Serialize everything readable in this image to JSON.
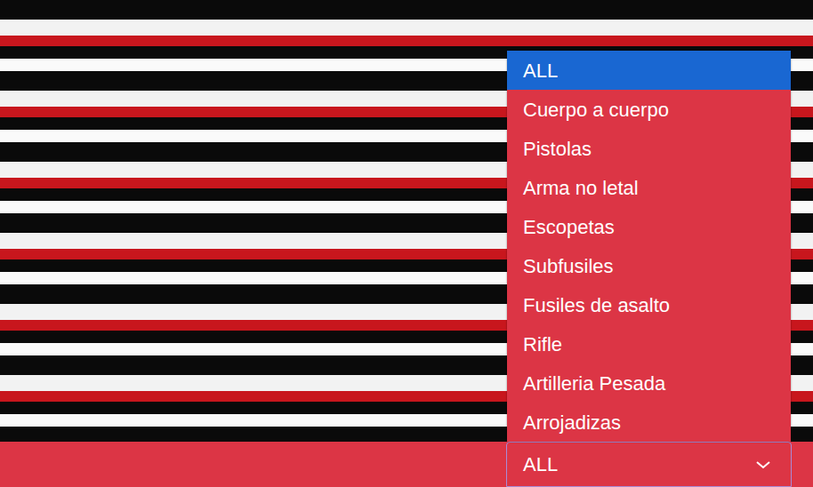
{
  "dropdown": {
    "value": "ALL",
    "expanded": true,
    "options": [
      {
        "label": "ALL",
        "selected": true
      },
      {
        "label": "Cuerpo a cuerpo",
        "selected": false
      },
      {
        "label": "Pistolas",
        "selected": false
      },
      {
        "label": "Arma no letal",
        "selected": false
      },
      {
        "label": "Escopetas",
        "selected": false
      },
      {
        "label": "Subfusiles",
        "selected": false
      },
      {
        "label": "Fusiles de asalto",
        "selected": false
      },
      {
        "label": "Rifle",
        "selected": false
      },
      {
        "label": "Artilleria Pesada",
        "selected": false
      },
      {
        "label": "Arrojadizas",
        "selected": false
      }
    ]
  }
}
